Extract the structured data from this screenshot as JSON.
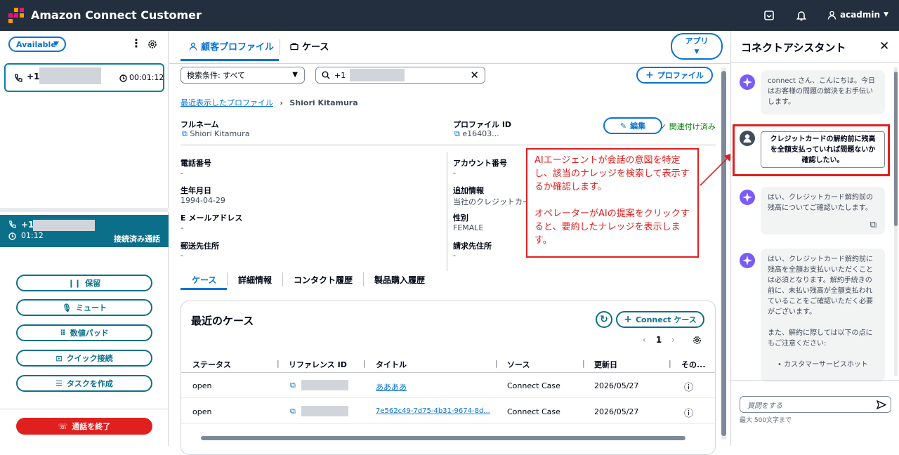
{
  "topbar": {
    "title": "Amazon Connect Customer",
    "user": "acadmin"
  },
  "left": {
    "status": "Available",
    "contact1": {
      "phone": "+1",
      "timer": "00:01:12"
    },
    "contact2": {
      "phone": "+1",
      "timer": "01:12",
      "state": "接続済み通話"
    },
    "buttons": {
      "hold": "保留",
      "mute": "ミュート",
      "numpad": "数値パッド",
      "quick": "クイック接続",
      "task": "タスクを作成"
    },
    "end_call": "通話を終了"
  },
  "mid": {
    "tabs": {
      "profile": "顧客プロファイル",
      "case": "ケース"
    },
    "app_btn": "アプリ",
    "search_filter": "検索条件: すべて",
    "search_value": "+1",
    "add_profile": "プロファイル",
    "breadcrumb": {
      "parent": "最近表示したプロファイル",
      "current": "Shiori Kitamura"
    },
    "fields": {
      "full_name_label": "フルネーム",
      "full_name": "Shiori Kitamura",
      "profile_id_label": "プロファイル ID",
      "profile_id": "e16403...",
      "edit": "編集",
      "linked": "関連付け済み",
      "phone_label": "電話番号",
      "phone": "-",
      "account_label": "アカウント番号",
      "account": "-",
      "birth_label": "生年月日",
      "birth": "1994-04-29",
      "extra_label": "追加情報",
      "extra": "当社のクレジットカー",
      "email_label": "E メールアドレス",
      "email": "-",
      "gender_label": "性別",
      "gender": "FEMALE",
      "mail_label": "郵送先住所",
      "mail": "-",
      "billing_label": "請求先住所",
      "billing": "-"
    },
    "profile_tabs": {
      "cases": "ケース",
      "details": "詳細情報",
      "history": "コンタクト履歴",
      "purchases": "製品購入履歴"
    },
    "card": {
      "title": "最近のケース",
      "new_case": "Connect ケース",
      "page": "1",
      "headers": {
        "status": "ステータス",
        "ref": "リファレンス ID",
        "title": "タイトル",
        "source": "ソース",
        "updated": "更新日",
        "other": "その..."
      },
      "rows": [
        {
          "status": "open",
          "title": "ああああ",
          "source": "Connect Case",
          "updated": "2026/05/27"
        },
        {
          "status": "open",
          "title": "7e562c49-7d75-4b31-9674-8d...",
          "source": "Connect Case",
          "updated": "2026/05/27"
        }
      ]
    },
    "annotation": {
      "p1": "AIエージェントが会話の意図を特定し、該当のナレッジを検索して表示するか確認します。",
      "p2": "オペレーターがAIの提案をクリックすると、要約したナレッジを表示します。"
    }
  },
  "right": {
    "title": "コネクトアシスタント",
    "messages": [
      "connect さん、こんにちは。今日はお客様の問題の解決をお手伝いします。",
      "クレジットカードの解約前に残高を全額支払っていれば問題ないか確認したい。",
      "はい、クレジットカード解約前の残高についてご確認いたします。",
      "はい、クレジットカード解約前に残高を全額お支払いいただくことは必須となります。解約手続きの前に、未払い残高が全額支払われていることをご確認いただく必要がございます。",
      "また、解約に際しては以下の点にもご注意ください:",
      "カスタマーサービスホット"
    ],
    "placeholder": "質問をする",
    "limit": "最大 500文字まで"
  },
  "colors": {
    "accent": "#0972d3",
    "teal": "#0b6f8a",
    "danger": "#e0201f",
    "nav": "#232f3e"
  }
}
